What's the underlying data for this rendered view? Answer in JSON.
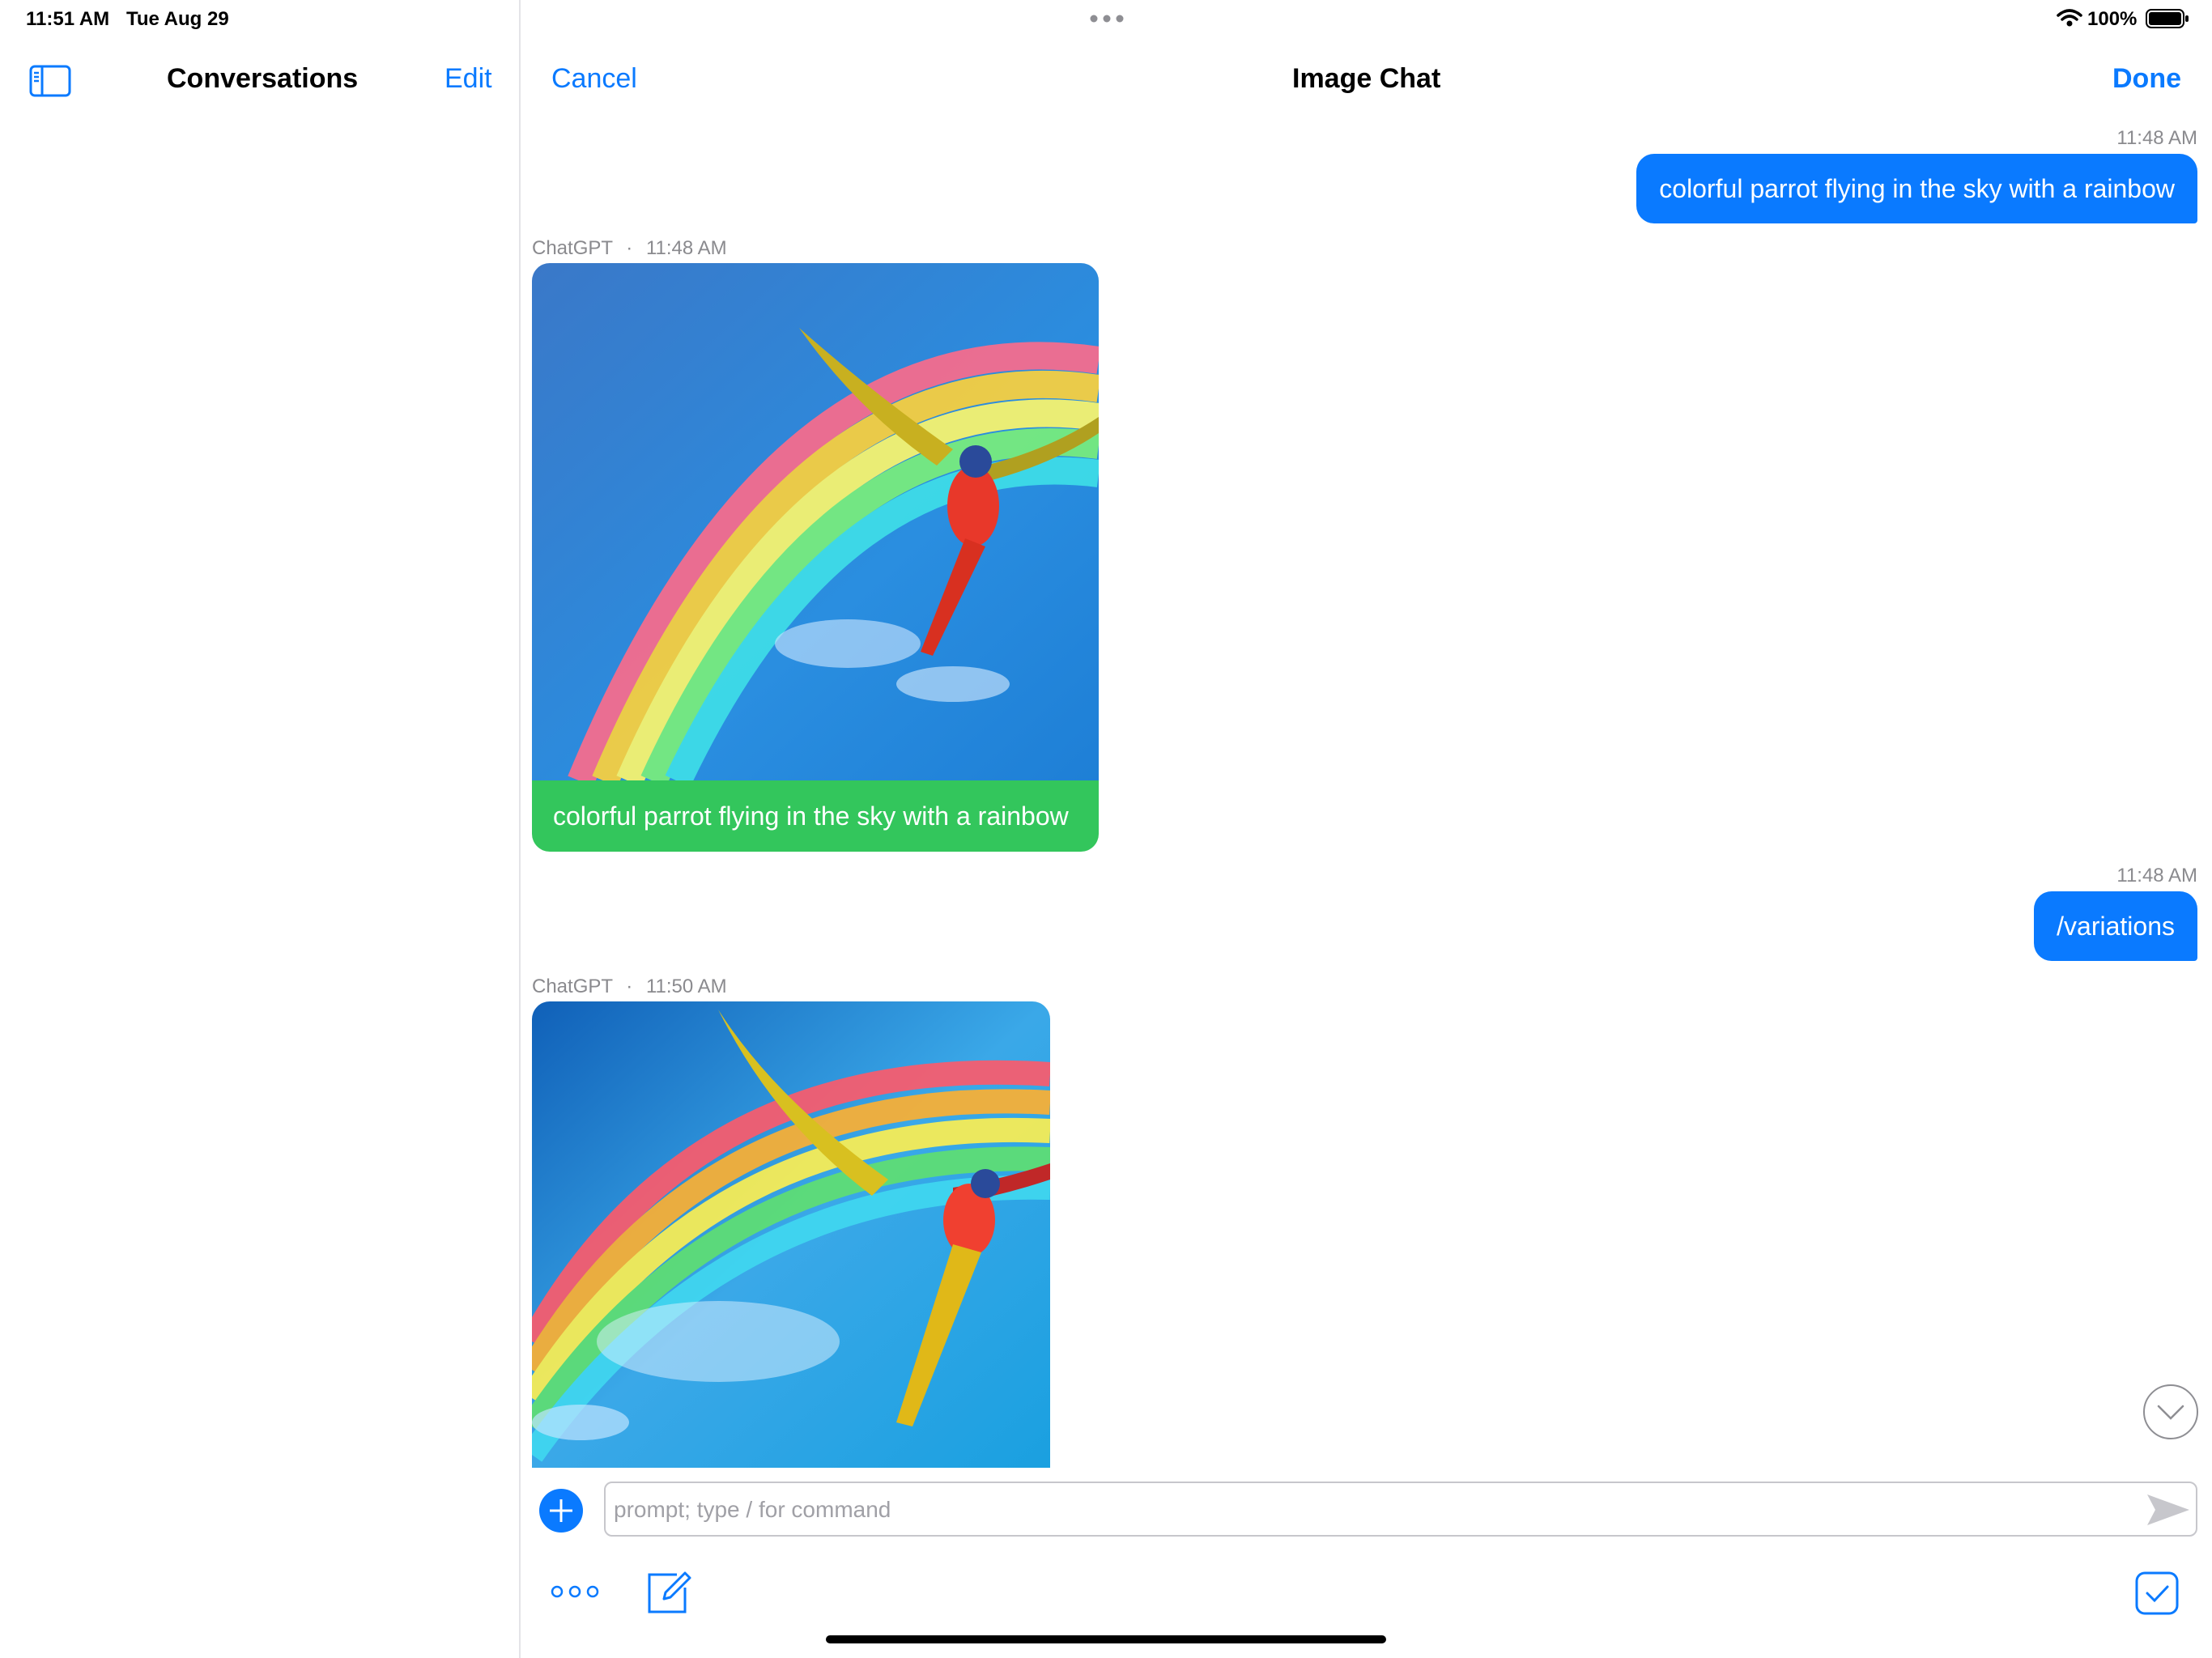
{
  "status_bar": {
    "time": "11:51 AM",
    "date": "Tue Aug 29",
    "battery": "100%"
  },
  "sidebar": {
    "title": "Conversations",
    "edit_label": "Edit"
  },
  "chat_header": {
    "cancel_label": "Cancel",
    "title": "Image Chat",
    "done_label": "Done"
  },
  "messages": [
    {
      "sender": "user",
      "time": "11:48 AM",
      "text": "colorful parrot flying in the sky with a rainbow"
    },
    {
      "sender": "ChatGPT",
      "separator": "·",
      "time": "11:48 AM",
      "caption": "colorful parrot flying in the sky with a rainbow"
    },
    {
      "sender": "user",
      "time": "11:48 AM",
      "text": "/variations"
    },
    {
      "sender": "ChatGPT",
      "separator": "·",
      "time": "11:50 AM"
    }
  ],
  "composer": {
    "placeholder": "prompt; type / for command",
    "value": ""
  },
  "colors": {
    "accent": "#0a7aff",
    "caption_green": "#33c65c",
    "sky_blue": "#1e90e0"
  },
  "icons": [
    "sidebar-toggle-icon",
    "plus-icon",
    "send-icon",
    "more-icon",
    "compose-icon",
    "checkbox-icon",
    "scroll-down-icon",
    "wifi-icon",
    "battery-icon"
  ]
}
